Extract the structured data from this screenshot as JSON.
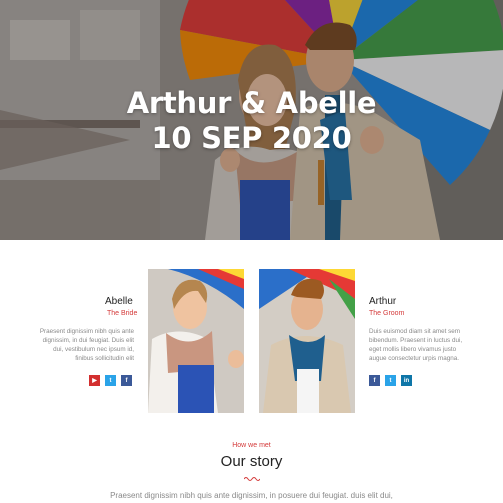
{
  "hero": {
    "names": "Arthur & Abelle",
    "date": "10 SEP 2020"
  },
  "bride": {
    "name": "Abelle",
    "role": "The Bride",
    "bio": "Praesent dignissim nibh quis ante dignissim, in dui feugiat. Duis elit dui, vestibulum nec ipsum id, finibus sollicitudin elit",
    "socials": [
      {
        "icon": "youtube-icon",
        "color": "#d32f2f"
      },
      {
        "icon": "twitter-icon",
        "color": "#2aa3e8"
      },
      {
        "icon": "facebook-icon",
        "color": "#3b5998"
      }
    ]
  },
  "groom": {
    "name": "Arthur",
    "role": "The Groom",
    "bio": "Duis euismod diam sit amet sem bibendum. Praesent in luctus dui, eget mollis libero vivamus justo augue consectetur urpis magna.",
    "socials": [
      {
        "icon": "facebook-icon",
        "color": "#3b5998"
      },
      {
        "icon": "twitter-icon",
        "color": "#2aa3e8"
      },
      {
        "icon": "linkedin-icon",
        "color": "#0e76a8"
      }
    ]
  },
  "story": {
    "kicker": "How we met",
    "title": "Our story",
    "text": "Praesent dignissim nibh quis ante dignissim, in posuere dui feugiat. duis elit dui,"
  },
  "colors": {
    "accent": "#d43a3a"
  }
}
